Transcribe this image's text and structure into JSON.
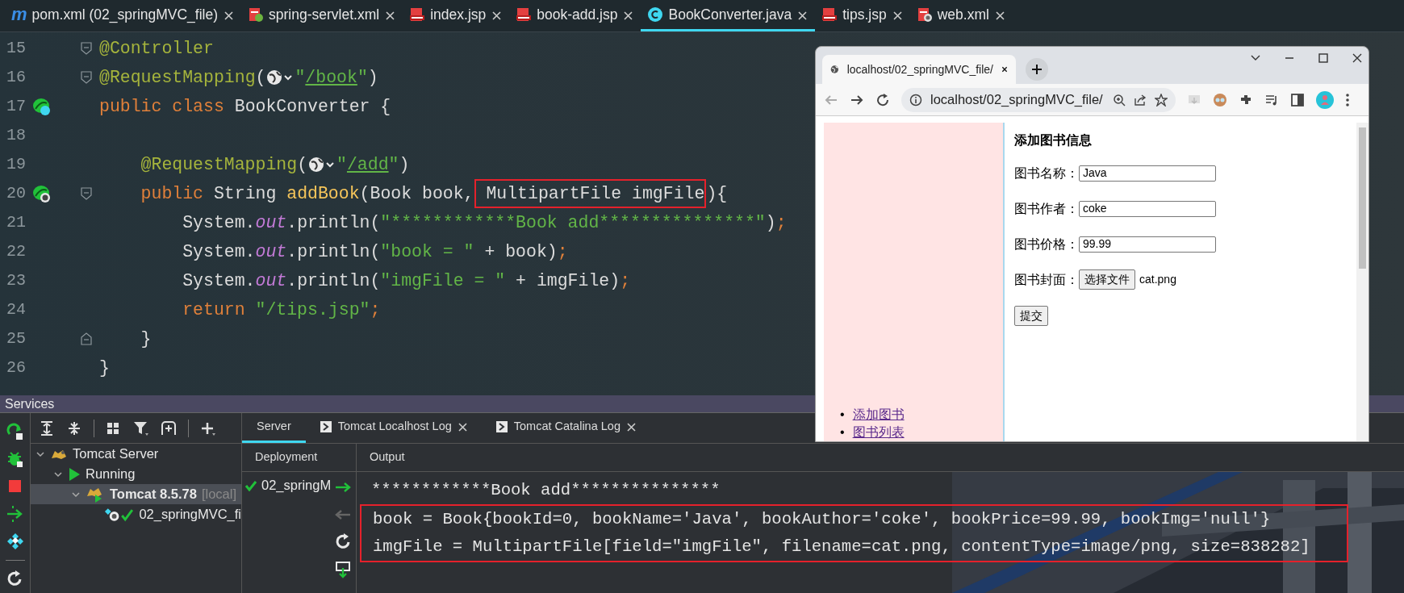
{
  "editor_tabs": [
    {
      "label": "pom.xml (02_springMVC_file)",
      "kind": "maven",
      "icon_label": "m",
      "selected": false
    },
    {
      "label": "spring-servlet.xml",
      "kind": "spring-xml",
      "selected": false
    },
    {
      "label": "index.jsp",
      "kind": "jsp",
      "selected": false
    },
    {
      "label": "book-add.jsp",
      "kind": "jsp",
      "selected": false
    },
    {
      "label": "BookConverter.java",
      "kind": "class",
      "selected": true
    },
    {
      "label": "tips.jsp",
      "kind": "jsp",
      "selected": false
    },
    {
      "label": "web.xml",
      "kind": "web-xml",
      "selected": false
    }
  ],
  "code_lines": [
    {
      "number": "15",
      "marks": [
        {
          "kind": "fold-start"
        }
      ],
      "segments": [
        {
          "kind": "code",
          "tokens": [
            {
              "kind": "annotation",
              "text": "@Controller"
            }
          ]
        }
      ]
    },
    {
      "number": "16",
      "marks": [
        {
          "kind": "fold-start"
        }
      ],
      "segments": [
        {
          "kind": "code",
          "tokens": [
            {
              "kind": "annotation",
              "text": "@RequestMapping"
            },
            {
              "kind": "plain",
              "text": "("
            }
          ]
        },
        {
          "kind": "globe"
        },
        {
          "kind": "code",
          "tokens": [
            {
              "kind": "string",
              "text": "\""
            },
            {
              "kind": "link",
              "text": "/book"
            },
            {
              "kind": "string",
              "text": "\""
            },
            {
              "kind": "plain",
              "text": ")"
            }
          ]
        }
      ]
    },
    {
      "number": "17",
      "marks": [
        {
          "kind": "bean-class"
        }
      ],
      "segments": [
        {
          "kind": "code",
          "tokens": [
            {
              "kind": "keyword",
              "text": "public class "
            },
            {
              "kind": "plain",
              "text": "BookConverter {"
            }
          ]
        }
      ]
    },
    {
      "number": "18"
    },
    {
      "number": "19",
      "segments": [
        {
          "kind": "code",
          "tokens": [
            {
              "kind": "annotation",
              "text": "    @RequestMapping"
            },
            {
              "kind": "plain",
              "text": "("
            }
          ]
        },
        {
          "kind": "globe"
        },
        {
          "kind": "code",
          "tokens": [
            {
              "kind": "string",
              "text": "\""
            },
            {
              "kind": "link",
              "text": "/add"
            },
            {
              "kind": "string",
              "text": "\""
            },
            {
              "kind": "plain",
              "text": ")"
            }
          ]
        }
      ]
    },
    {
      "number": "20",
      "marks": [
        {
          "kind": "bean-web"
        },
        {
          "kind": "fold-start"
        }
      ],
      "segments": [
        {
          "kind": "code",
          "tokens": [
            {
              "kind": "keyword",
              "text": "    public "
            },
            {
              "kind": "plain",
              "text": "String "
            },
            {
              "kind": "method",
              "text": "addBook"
            },
            {
              "kind": "plain",
              "text": "(Book book,"
            }
          ]
        },
        {
          "kind": "code",
          "highlighted": true,
          "tokens": [
            {
              "kind": "plain",
              "text": " MultipartFile imgFile"
            }
          ]
        },
        {
          "kind": "code",
          "tokens": [
            {
              "kind": "plain",
              "text": "){"
            }
          ]
        }
      ]
    },
    {
      "number": "21",
      "segments": [
        {
          "kind": "code",
          "tokens": [
            {
              "kind": "plain",
              "text": "        System."
            },
            {
              "kind": "field",
              "text": "out"
            },
            {
              "kind": "plain",
              "text": ".println("
            },
            {
              "kind": "string",
              "text": "\"************Book add***************\""
            },
            {
              "kind": "plain",
              "text": ")"
            },
            {
              "kind": "keyword",
              "text": ";"
            }
          ]
        }
      ]
    },
    {
      "number": "22",
      "segments": [
        {
          "kind": "code",
          "tokens": [
            {
              "kind": "plain",
              "text": "        System."
            },
            {
              "kind": "field",
              "text": "out"
            },
            {
              "kind": "plain",
              "text": ".println("
            },
            {
              "kind": "string",
              "text": "\"book = \""
            },
            {
              "kind": "plain",
              "text": " + book)"
            },
            {
              "kind": "keyword",
              "text": ";"
            }
          ]
        }
      ]
    },
    {
      "number": "23",
      "segments": [
        {
          "kind": "code",
          "tokens": [
            {
              "kind": "plain",
              "text": "        System."
            },
            {
              "kind": "field",
              "text": "out"
            },
            {
              "kind": "plain",
              "text": ".println("
            },
            {
              "kind": "string",
              "text": "\"imgFile = \""
            },
            {
              "kind": "plain",
              "text": " + imgFile)"
            },
            {
              "kind": "keyword",
              "text": ";"
            }
          ]
        }
      ]
    },
    {
      "number": "24",
      "segments": [
        {
          "kind": "code",
          "tokens": [
            {
              "kind": "keyword",
              "text": "        return "
            },
            {
              "kind": "string",
              "text": "\"/tips.jsp\""
            },
            {
              "kind": "keyword",
              "text": ";"
            }
          ]
        }
      ]
    },
    {
      "number": "25",
      "marks": [
        {
          "kind": "fold-end"
        }
      ],
      "segments": [
        {
          "kind": "code",
          "tokens": [
            {
              "kind": "plain",
              "text": "    }"
            }
          ]
        }
      ]
    },
    {
      "number": "26",
      "segments": [
        {
          "kind": "code",
          "tokens": [
            {
              "kind": "plain",
              "text": "}"
            }
          ]
        }
      ]
    }
  ],
  "services": {
    "title": "Services",
    "tree": [
      {
        "label": "Tomcat Server",
        "kind": "tomcat",
        "expanded": true,
        "selected": false,
        "children": [
          {
            "label": "Running",
            "kind": "run",
            "expanded": true,
            "selected": false,
            "children": [
              {
                "label": "Tomcat 8.5.78",
                "suffix": "[local]",
                "kind": "tomcat-run",
                "expanded": true,
                "selected": true,
                "children": [
                  {
                    "label": "02_springMVC_fi",
                    "kind": "artifact",
                    "selected": false
                  }
                ]
              }
            ]
          }
        ]
      }
    ],
    "tabs": [
      {
        "label": "Server",
        "selected": true,
        "closable": false
      },
      {
        "label": "Tomcat Localhost Log",
        "selected": false,
        "closable": true
      },
      {
        "label": "Tomcat Catalina Log",
        "selected": false,
        "closable": true
      }
    ],
    "deployment": {
      "header": "Deployment",
      "items": [
        {
          "label": "02_springM",
          "deployed": true
        }
      ]
    },
    "output": {
      "header": "Output",
      "lines": [
        {
          "text": "************Book add***************",
          "highlighted": false
        },
        {
          "text": "book = Book{bookId=0, bookName='Java', bookAuthor='coke', bookPrice=99.99, bookImg='null'}",
          "highlighted": true
        },
        {
          "text": "imgFile = MultipartFile[field=\"imgFile\", filename=cat.png, contentType=image/png, size=838282]",
          "highlighted": true
        }
      ]
    }
  },
  "browser": {
    "tab_title": "localhost/02_springMVC_file/",
    "url": "localhost/02_springMVC_file/",
    "sidebar_links": [
      {
        "bullet": "•",
        "text": "添加图书"
      },
      {
        "bullet": "•",
        "text": "图书列表"
      }
    ],
    "form": {
      "title": "添加图书信息",
      "fields": [
        {
          "label": "图书名称：",
          "kind": "text",
          "value": "Java"
        },
        {
          "label": "图书作者：",
          "kind": "text",
          "value": "coke"
        },
        {
          "label": "图书价格：",
          "kind": "text",
          "value": "99.99"
        },
        {
          "label": "图书封面：",
          "kind": "file",
          "button": "选择文件",
          "value": "cat.png"
        }
      ],
      "submit": "提交"
    }
  }
}
